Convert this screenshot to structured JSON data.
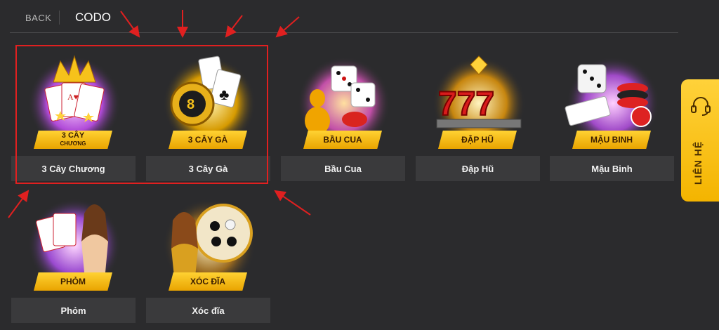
{
  "header": {
    "back_label": "BACK",
    "title": "CODO"
  },
  "games": [
    {
      "name": "3 Cây Chương",
      "badge_line1": "3 CÂY",
      "badge_line2": "CHƯƠNG"
    },
    {
      "name": "3 Cây Gà",
      "badge": "3 CÂY GÀ"
    },
    {
      "name": "Bầu Cua",
      "badge": "BẦU CUA"
    },
    {
      "name": "Đập Hũ",
      "badge": "ĐẬP HŨ"
    },
    {
      "name": "Mậu Binh",
      "badge": "MẬU BINH"
    },
    {
      "name": "Phỏm",
      "badge": "PHỎM"
    },
    {
      "name": "Xóc đĩa",
      "badge": "XÓC ĐĨA"
    }
  ],
  "contact": {
    "label": "LIÊN HỆ"
  },
  "colors": {
    "accent": "#f4b400",
    "annotation": "#e02020",
    "background": "#2b2b2d",
    "label_bg": "#3a3a3c"
  }
}
